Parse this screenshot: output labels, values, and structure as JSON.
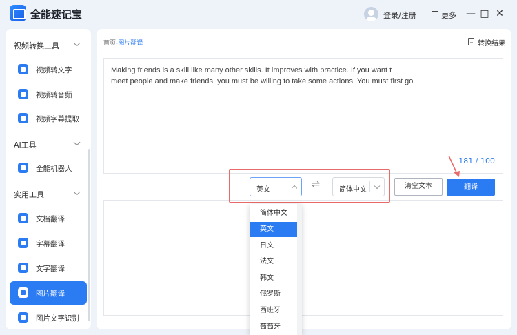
{
  "app": {
    "title": "全能速记宝"
  },
  "header": {
    "login_label": "登录/注册",
    "more_label": "更多",
    "minimize": "—",
    "maximize": "□",
    "close": "✕"
  },
  "sidebar": {
    "groups": [
      {
        "label": "视频转换工具",
        "items": [
          {
            "label": "视频转文字"
          },
          {
            "label": "视频转音频"
          },
          {
            "label": "视频字幕提取"
          }
        ]
      },
      {
        "label": "AI工具",
        "items": [
          {
            "label": "全能机器人"
          }
        ]
      },
      {
        "label": "实用工具",
        "items": [
          {
            "label": "文档翻译"
          },
          {
            "label": "字幕翻译"
          },
          {
            "label": "文字翻译"
          },
          {
            "label": "图片翻译",
            "active": true
          },
          {
            "label": "图片文字识别"
          }
        ]
      }
    ]
  },
  "main": {
    "breadcrumb": {
      "home": "首页",
      "sep": "-",
      "current": "图片翻译"
    },
    "result_label": "转换结果",
    "source_lines": [
      "Making friends is a skill like many other skills. It improves with practice. If you want t",
      "meet people and make friends, you must be willing to take some actions. You must first go"
    ],
    "char_count": "181 / 100",
    "source_lang": "英文",
    "target_lang": "简体中文",
    "swap_symbol": "⇌",
    "clear_label": "清空文本",
    "translate_label": "翻译",
    "dropdown_options": [
      "简体中文",
      "英文",
      "日文",
      "法文",
      "韩文",
      "俄罗斯",
      "西班牙",
      "葡萄牙"
    ],
    "dropdown_selected": "英文"
  },
  "colors": {
    "accent": "#2b7bf3",
    "highlight": "#e86a6a",
    "background": "#eef2f9"
  }
}
